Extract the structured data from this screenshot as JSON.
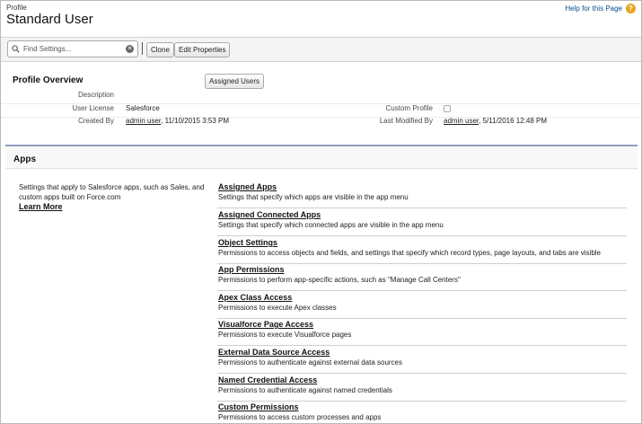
{
  "header": {
    "breadcrumb": "Profile",
    "title": "Standard User",
    "help_link": "Help for this Page",
    "help_icon": "help-icon"
  },
  "toolbar": {
    "search_placeholder": "Find Settings...",
    "clone_label": "Clone",
    "edit_properties_label": "Edit Properties"
  },
  "overview": {
    "title": "Profile Overview",
    "assigned_users_label": "Assigned Users",
    "fields": {
      "description_label": "Description",
      "description_value": "",
      "user_license_label": "User License",
      "user_license_value": "Salesforce",
      "custom_profile_label": "Custom Profile",
      "custom_profile_checked": false,
      "created_by_label": "Created By",
      "created_by_user": "admin user",
      "created_by_date": ", 11/10/2015 3:53 PM",
      "last_modified_label": "Last Modified By",
      "last_modified_user": "admin user",
      "last_modified_date": ", 5/11/2016 12:48 PM"
    }
  },
  "apps": {
    "title": "Apps",
    "description": "Settings that apply to Salesforce apps, such as Sales, and custom apps built on Force.com",
    "learn_more": "Learn More",
    "items": [
      {
        "name": "Assigned Apps",
        "desc": "Settings that specify which apps are visible in the app menu"
      },
      {
        "name": "Assigned Connected Apps",
        "desc": "Settings that specify which connected apps are visible in the app menu"
      },
      {
        "name": "Object Settings",
        "desc": "Permissions to access objects and fields, and settings that specify which record types, page layouts, and tabs are visible"
      },
      {
        "name": "App Permissions",
        "desc": "Permissions to perform app-specific actions, such as \"Manage Call Centers\""
      },
      {
        "name": "Apex Class Access",
        "desc": "Permissions to execute Apex classes"
      },
      {
        "name": "Visualforce Page Access",
        "desc": "Permissions to execute Visualforce pages"
      },
      {
        "name": "External Data Source Access",
        "desc": "Permissions to authenticate against external data sources"
      },
      {
        "name": "Named Credential Access",
        "desc": "Permissions to authenticate against named credentials"
      },
      {
        "name": "Custom Permissions",
        "desc": "Permissions to access custom processes and apps"
      }
    ]
  }
}
